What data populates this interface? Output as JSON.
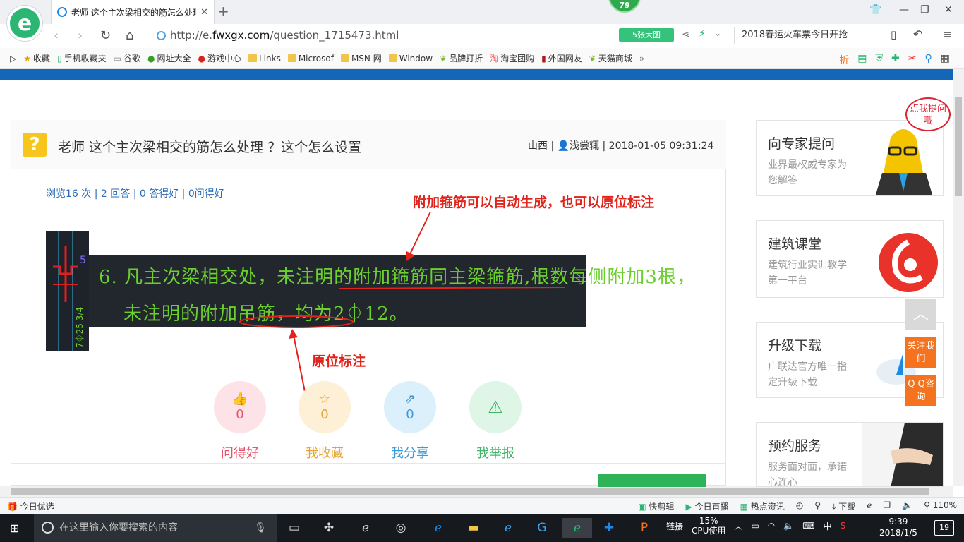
{
  "browser": {
    "badge_count": "79",
    "tab_title": "老师 这个主次梁相交的筋怎么处理",
    "new_tab_symbol": "+",
    "url_prefix": "http://e.",
    "url_domain": "fwxgx.com",
    "url_path": "/question_1715473.html",
    "big_image_label": "5张大图",
    "search_text": "2018春运火车票今日开抢",
    "bookmarks": [
      {
        "label": "收藏",
        "icon": "star-icon"
      },
      {
        "label": "手机收藏夹",
        "icon": "phone-icon"
      },
      {
        "label": "谷歌",
        "icon": "page-icon"
      },
      {
        "label": "网址大全",
        "icon": "globe-icon"
      },
      {
        "label": "游戏中心",
        "icon": "game-icon"
      },
      {
        "label": "Links",
        "icon": "folder-icon"
      },
      {
        "label": "Microsof",
        "icon": "folder-icon"
      },
      {
        "label": "MSN 网",
        "icon": "folder-icon"
      },
      {
        "label": "Window",
        "icon": "folder-icon"
      },
      {
        "label": "品牌打折",
        "icon": "leaf-icon"
      },
      {
        "label": "淘宝团购",
        "icon": "taobao-icon"
      },
      {
        "label": "外国网友",
        "icon": "flag-icon"
      },
      {
        "label": "天猫商城",
        "icon": "leaf-icon"
      }
    ]
  },
  "question": {
    "title": "老师 这个主次梁相交的筋怎么处理 ？这个怎么设置",
    "meta": "山西 | 👤浅尝辄 | 2018-01-05 09:31:24",
    "stats": "浏览16 次 | 2 回答 | 0 答得好 | 0问得好",
    "cad_line1": "6. 凡主次梁相交处，未注明的附加箍筋同主梁箍筋,根数每侧附加3根，",
    "cad_line2": "未注明的附加吊筋，均为2⏀12。",
    "annotation_top": "附加箍筋可以自动生成，也可以原位标注",
    "annotation_bottom": "原位标注",
    "actions": [
      {
        "label": "问得好",
        "count": "0",
        "icon": "thumbs-up-icon",
        "color": "#e8546a",
        "bg": "#fde3e7"
      },
      {
        "label": "我收藏",
        "count": "0",
        "icon": "star-icon",
        "color": "#e3a53a",
        "bg": "#fdf0d6"
      },
      {
        "label": "我分享",
        "count": "0",
        "icon": "share-icon",
        "color": "#3d9ad8",
        "bg": "#dcf0fc"
      },
      {
        "label": "我举报",
        "count": "",
        "icon": "warning-icon",
        "color": "#3fb56a",
        "bg": "#dff5e6"
      }
    ]
  },
  "sidebar": {
    "bubble": "点我提问哦",
    "cards": [
      {
        "title": "向专家提问",
        "desc": "业界最权威专家为您解答"
      },
      {
        "title": "建筑课堂",
        "desc": "建筑行业实训教学第一平台"
      },
      {
        "title": "升级下载",
        "desc": "广联达官方唯一指定升级下载"
      },
      {
        "title": "预约服务",
        "desc": "服务面对面，承诺心连心"
      }
    ],
    "follow_btn": "关注我们",
    "qq_btn": "Q Q咨询"
  },
  "statusbar": {
    "left": "今日优选",
    "right": [
      "快剪辑",
      "今日直播",
      "热点资讯",
      "下载",
      "110%"
    ]
  },
  "taskbar": {
    "search_placeholder": "在这里输入你要搜索的内容",
    "tray_link": "链接",
    "cpu_percent": "15%",
    "cpu_label": "CPU使用",
    "ime": "中",
    "time": "9:39",
    "date": "2018/1/5",
    "notifications": "19"
  }
}
